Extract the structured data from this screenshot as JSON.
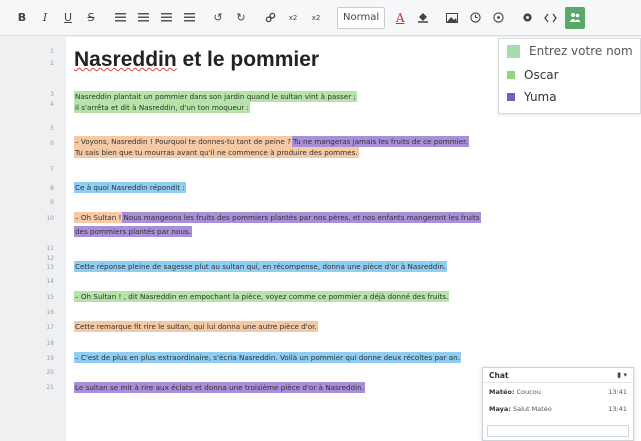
{
  "toolbar": {
    "bold": "B",
    "italic": "I",
    "underline": "U",
    "strike": "S",
    "undo": "↺",
    "redo": "↻",
    "superscript": "x",
    "subscript": "x",
    "style_select": "Normal",
    "font_color": "A"
  },
  "editor": {
    "title": "Nasreddin et le pommier",
    "line_numbers": [
      "1",
      "2",
      "3",
      "4",
      "5",
      "6",
      "7",
      "8",
      "9",
      "10",
      "11",
      "12",
      "13",
      "14",
      "15",
      "16",
      "17",
      "18",
      "19",
      "20",
      "21"
    ],
    "paragraphs": [
      [
        "Nasreddin plantait un pommier dans son jardin quand le sultan vint à passer ;",
        "il s'arrêta et dit à Nasreddin, d'un ton moqueur :"
      ],
      [
        "– Voyons, Nasreddin ! Pourquoi te donnes-tu tant de peine ?",
        "Tu ne mangeras jamais les fruits de ce pommier.",
        "Tu sais bien que tu mourras avant qu'il ne commence à produire des pommes."
      ],
      [
        "Ce à quoi Nasreddin répondit :"
      ],
      [
        "– Oh Sultan !",
        "Nous mangeons les fruits des pommiers plantés par nos pères, et nos enfants mangeront les fruits",
        "des pommiers plantés par nous."
      ],
      [
        "Cette réponse pleine de sagesse plut au sultan qui, en récompense, donna une pièce d'or à Nasreddin."
      ],
      [
        "– Oh Sultan ! , dit Nasreddin en empochant la pièce, voyez comme ce pommier a déjà donné des fruits."
      ],
      [
        "Cette remarque fit rire le sultan, qui lui donna une autre pièce d'or."
      ],
      [
        "– C'est de plus en plus extraordinaire, s'écria Nasreddin. Voilà un pommier qui donne deux récoltes par an."
      ],
      [
        "Le sultan se mit à rire aux éclats et donna une troisième pièce d'or à Nasreddin."
      ]
    ]
  },
  "authors": {
    "input_placeholder": "Entrez votre nom",
    "users": [
      {
        "name": "Oscar",
        "color": "#8fd67a"
      },
      {
        "name": "Yuma",
        "color": "#7a5cc6"
      }
    ],
    "self_color": "#a8dcb0"
  },
  "chat": {
    "title": "Chat",
    "messages": [
      {
        "author": "Matéo:",
        "text": "Coucou",
        "time": "13:41"
      },
      {
        "author": "Maya:",
        "text": "Salut Matéo",
        "time": "13:41"
      }
    ]
  },
  "colors": {
    "green": "#b5e3a8",
    "orange": "#f6c9a5",
    "blue": "#8fcdf2",
    "purple": "#a88fd8",
    "active_button": "#58a868"
  },
  "icons": [
    "ordered-list-icon",
    "unordered-list-icon",
    "indent-icon",
    "outdent-icon",
    "link-icon",
    "paint-bucket-icon",
    "image-icon",
    "clock-icon",
    "history-icon",
    "settings-icon",
    "code-icon",
    "users-icon",
    "chat-menu-icon",
    "minimize-icon"
  ]
}
